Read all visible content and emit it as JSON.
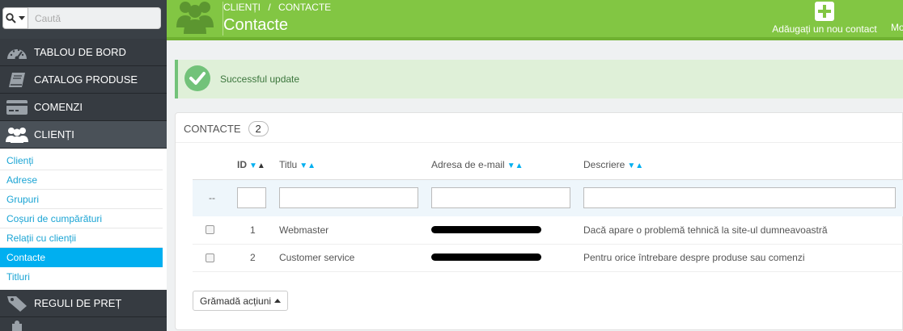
{
  "search": {
    "placeholder": "Caută"
  },
  "sidebar": {
    "items": [
      {
        "label": "TABLOU DE BORD",
        "icon": "dashboard-icon"
      },
      {
        "label": "CATALOG PRODUSE",
        "icon": "book-icon"
      },
      {
        "label": "COMENZI",
        "icon": "credit-card-icon"
      },
      {
        "label": "CLIENȚI",
        "icon": "users-icon"
      }
    ],
    "submenu": [
      "Clienți",
      "Adrese",
      "Grupuri",
      "Coșuri de cumpărături",
      "Relații cu clienții",
      "Contacte",
      "Titluri"
    ],
    "active_sub": "Contacte",
    "bottom_items": [
      {
        "label": "REGULI DE PREȚ",
        "icon": "tag-icon"
      }
    ]
  },
  "header": {
    "breadcrumb_parent": "CLIENȚI",
    "breadcrumb_sep": "/",
    "breadcrumb_current": "CONTACTE",
    "title": "Contacte",
    "add_label": "Adăugați un nou contact",
    "more_label": "Mo"
  },
  "alert": {
    "text": "Successful update"
  },
  "panel": {
    "title": "CONTACTE",
    "count": "2",
    "columns": [
      "ID",
      "Titlu",
      "Adresa de e-mail",
      "Descriere"
    ],
    "filter_placeholder": "--",
    "rows": [
      {
        "id": "1",
        "title": "Webmaster",
        "description": "Dacă apare o problemă tehnică la site-ul dumneavoastră"
      },
      {
        "id": "2",
        "title": "Customer service",
        "description": "Pentru orice întrebare despre produse sau comenzi"
      }
    ],
    "bulk_label": "Grămadă acțiuni"
  },
  "colors": {
    "header_green": "#82c643",
    "accent_blue": "#00aff0",
    "sidebar": "#2d3237"
  }
}
